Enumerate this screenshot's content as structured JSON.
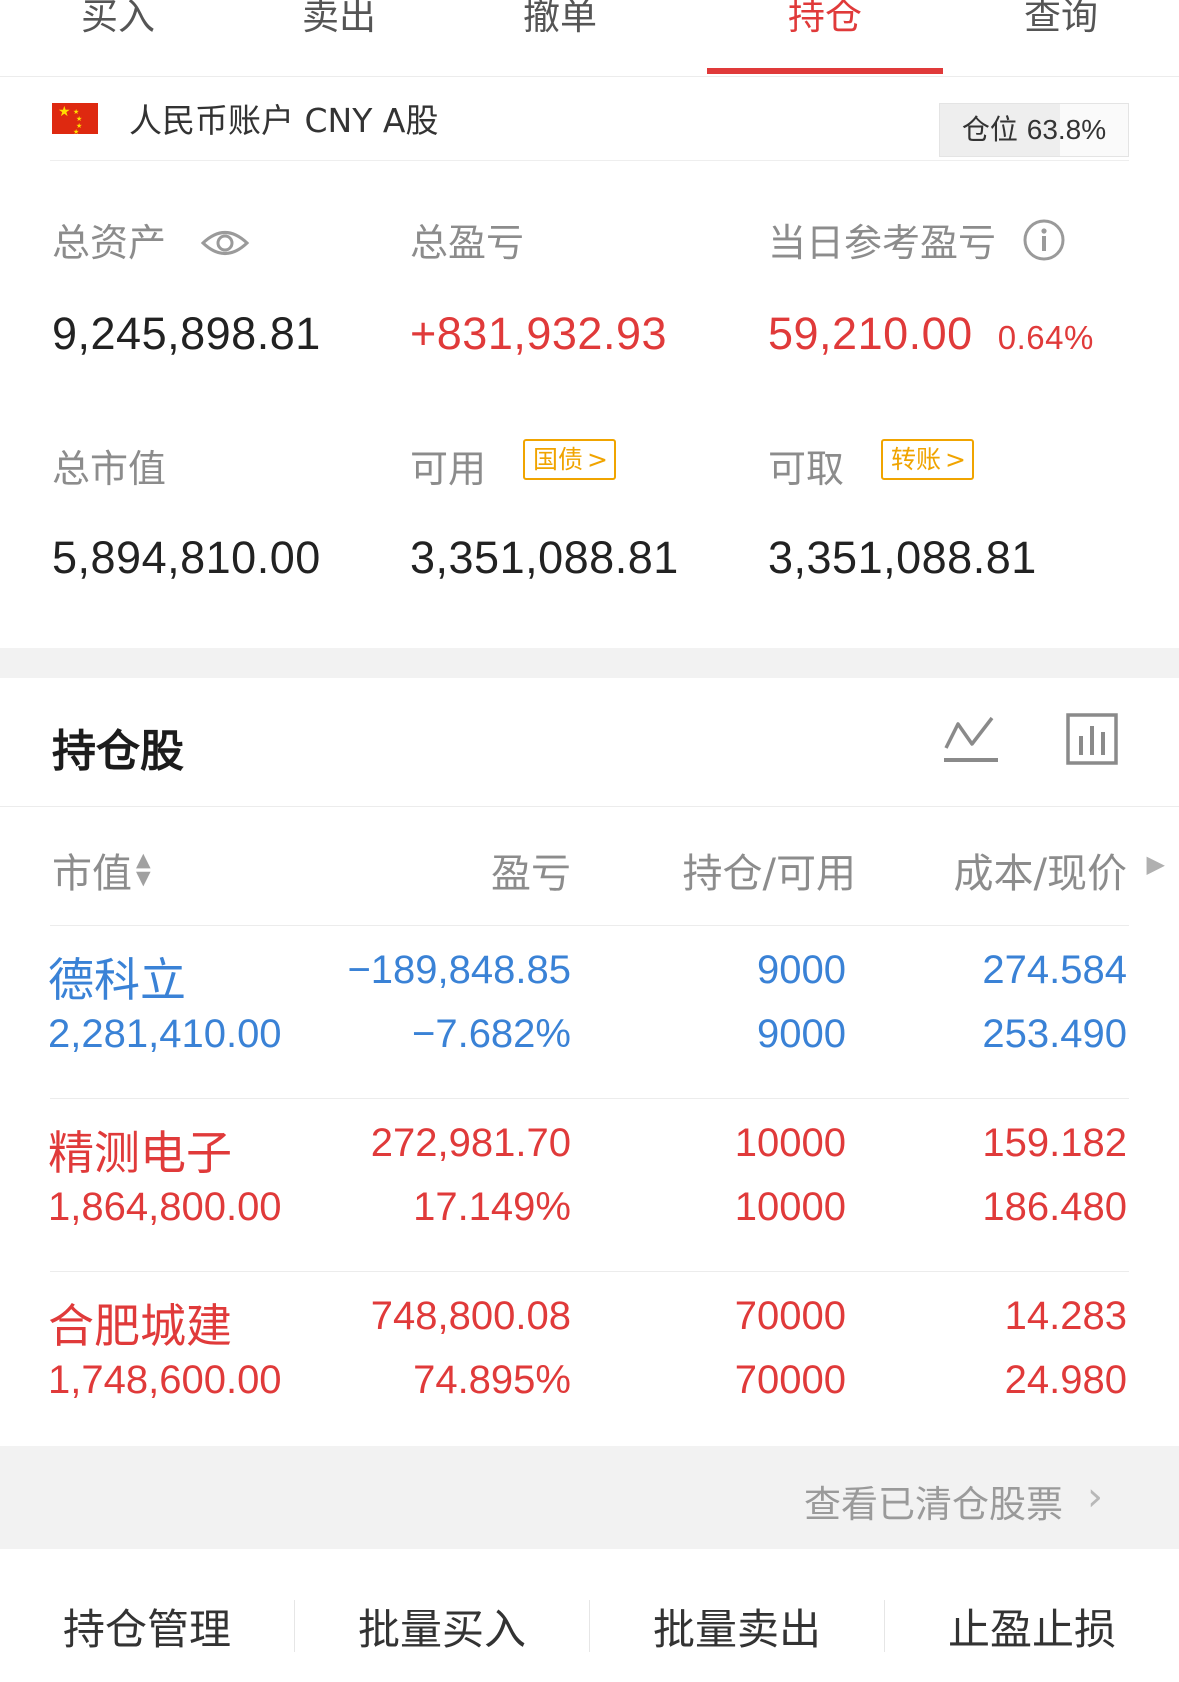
{
  "tabs": [
    {
      "label": "买入",
      "active": false
    },
    {
      "label": "卖出",
      "active": false
    },
    {
      "label": "撤单",
      "active": false
    },
    {
      "label": "持仓",
      "active": true
    },
    {
      "label": "查询",
      "active": false
    }
  ],
  "account": {
    "flag_icon": "china-flag-icon",
    "label": "人民币账户 CNY A股",
    "position_label": "仓位",
    "position_value": "63.8%",
    "position_fraction": 0.638
  },
  "summary": {
    "total_assets": {
      "label": "总资产",
      "value": "9,245,898.81",
      "icon": "eye-icon"
    },
    "total_pl": {
      "label": "总盈亏",
      "value": "+831,932.93"
    },
    "daily_pl": {
      "label": "当日参考盈亏",
      "value": "59,210.00",
      "pct": "0.64%",
      "icon": "info-icon"
    },
    "market_value": {
      "label": "总市值",
      "value": "5,894,810.00"
    },
    "available": {
      "label": "可用",
      "value": "3,351,088.81",
      "badge": "国债"
    },
    "withdrawable": {
      "label": "可取",
      "value": "3,351,088.81",
      "badge": "转账"
    }
  },
  "holdings": {
    "title": "持仓股",
    "columns": [
      "市值",
      "盈亏",
      "持仓/可用",
      "成本/现价"
    ],
    "rows": [
      {
        "name": "德科立",
        "market_value": "2,281,410.00",
        "pl": "−189,848.85",
        "pl_pct": "−7.682%",
        "position": "9000",
        "available": "9000",
        "cost": "274.584",
        "price": "253.490",
        "trend": "down"
      },
      {
        "name": "精测电子",
        "market_value": "1,864,800.00",
        "pl": "272,981.70",
        "pl_pct": "17.149%",
        "position": "10000",
        "available": "10000",
        "cost": "159.182",
        "price": "186.480",
        "trend": "up"
      },
      {
        "name": "合肥城建",
        "market_value": "1,748,600.00",
        "pl": "748,800.08",
        "pl_pct": "74.895%",
        "position": "70000",
        "available": "70000",
        "cost": "14.283",
        "price": "24.980",
        "trend": "up"
      }
    ]
  },
  "cleared_link": "查看已清仓股票",
  "actions": [
    "持仓管理",
    "批量买入",
    "批量卖出",
    "止盈止损"
  ],
  "colors": {
    "up": "#e03a3a",
    "down": "#3a82d6",
    "accent": "#e03a3a",
    "badge": "#f0a400"
  }
}
